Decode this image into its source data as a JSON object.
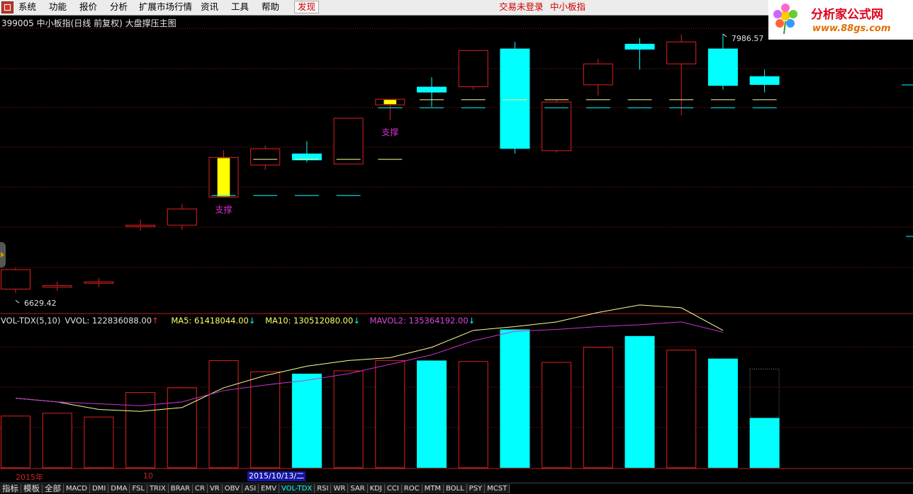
{
  "menu": {
    "items": [
      "系统",
      "功能",
      "报价",
      "分析",
      "扩展市场行情",
      "资讯",
      "工具",
      "帮助"
    ],
    "discover_label": "发现",
    "login_status": "交易未登录",
    "security_name": "中小板指"
  },
  "brand": {
    "title": "分析家公式网",
    "url": "www.88gs.com"
  },
  "chart": {
    "title": "399005 中小板指(日线 前复权) 大盘撑压主图",
    "high_label": "7986.57",
    "low_label": "6629.42",
    "support_label": "支撑"
  },
  "indicator": {
    "name": "VOL-TDX(5,10)",
    "vvol": "VVOL: 122836088.00",
    "vvol_arrow": "↑",
    "ma5": "MA5: 61418044.00",
    "ma5_arrow": "↓",
    "ma10": "MA10: 130512080.00",
    "ma10_arrow": "↓",
    "mavol2": "MAVOL2: 135364192.00",
    "mavol2_arrow": "↓"
  },
  "axis": {
    "year_label": "2015年",
    "month_label": "10",
    "selected_date": "2015/10/13/二"
  },
  "tabs": [
    "指标",
    "模板",
    "全部",
    "MACD",
    "DMI",
    "DMA",
    "FSL",
    "TRIX",
    "BRAR",
    "CR",
    "VR",
    "OBV",
    "ASI",
    "EMV",
    "VOL-TDX",
    "RSI",
    "WR",
    "SAR",
    "KDJ",
    "CCI",
    "ROC",
    "MTM",
    "BOLL",
    "PSY",
    "MCST"
  ],
  "active_tab": "VOL-TDX",
  "colors": {
    "up": "#e02020",
    "down": "#00ffff",
    "highlight": "#ffff00",
    "ma_yellow": "#ffff99",
    "ma_purple": "#cc33cc",
    "grid": "#8b1a1a",
    "support_text": "#cc33cc"
  },
  "chart_data": {
    "type": "candlestick",
    "price_range": [
      6629.42,
      7986.57
    ],
    "candles": [
      {
        "o": 6650,
        "c": 6752,
        "h": 6760,
        "l": 6629,
        "dir": "up"
      },
      {
        "o": 6668,
        "c": 6660,
        "h": 6690,
        "l": 6640,
        "dir": "up"
      },
      {
        "o": 6688,
        "c": 6685,
        "h": 6708,
        "l": 6660,
        "dir": "up"
      },
      {
        "o": 6985,
        "c": 6978,
        "h": 7015,
        "l": 6955,
        "dir": "up"
      },
      {
        "o": 6985,
        "c": 7070,
        "h": 7095,
        "l": 6960,
        "dir": "up"
      },
      {
        "o": 7132,
        "c": 7340,
        "h": 7378,
        "l": 7128,
        "dir": "up",
        "fill": "#ffff00"
      },
      {
        "o": 7300,
        "c": 7385,
        "h": 7400,
        "l": 7275,
        "dir": "up"
      },
      {
        "o": 7360,
        "c": 7325,
        "h": 7425,
        "l": 7315,
        "dir": "down"
      },
      {
        "o": 7305,
        "c": 7545,
        "h": 7545,
        "l": 7305,
        "dir": "up"
      },
      {
        "o": 7615,
        "c": 7645,
        "h": 7645,
        "l": 7535,
        "dir": "up",
        "fill": "#ffff00"
      },
      {
        "o": 7710,
        "c": 7680,
        "h": 7760,
        "l": 7605,
        "dir": "down"
      },
      {
        "o": 7710,
        "c": 7900,
        "h": 7900,
        "l": 7695,
        "dir": "up"
      },
      {
        "o": 7910,
        "c": 7385,
        "h": 7945,
        "l": 7360,
        "dir": "down"
      },
      {
        "o": 7375,
        "c": 7630,
        "h": 7640,
        "l": 7365,
        "dir": "up"
      },
      {
        "o": 7720,
        "c": 7830,
        "h": 7855,
        "l": 7665,
        "dir": "up"
      },
      {
        "o": 7935,
        "c": 7905,
        "h": 7965,
        "l": 7800,
        "dir": "down"
      },
      {
        "o": 7830,
        "c": 7945,
        "h": 7985,
        "l": 7560,
        "dir": "up"
      },
      {
        "o": 7910,
        "c": 7715,
        "h": 7986.57,
        "l": 7695,
        "dir": "down"
      },
      {
        "o": 7765,
        "c": 7720,
        "h": 7800,
        "l": 7680,
        "dir": "down"
      }
    ],
    "support_levels": [
      {
        "from": 5,
        "to": 8,
        "value": 7140,
        "color": "#00ffff"
      },
      {
        "from": 6,
        "to": 9,
        "value": 7330,
        "color": "#ffff99"
      },
      {
        "from": 9,
        "to": 18,
        "value": 7600,
        "color": "#00ffff"
      },
      {
        "from": 10,
        "to": 18,
        "value": 7642,
        "color": "#ffff99"
      }
    ],
    "support_marks": [
      {
        "index": 5
      },
      {
        "index": 9
      }
    ],
    "volume": [
      {
        "v": 55,
        "dir": "up"
      },
      {
        "v": 58,
        "dir": "up"
      },
      {
        "v": 54,
        "dir": "up"
      },
      {
        "v": 80,
        "dir": "up"
      },
      {
        "v": 85,
        "dir": "up"
      },
      {
        "v": 114,
        "dir": "up"
      },
      {
        "v": 102,
        "dir": "up"
      },
      {
        "v": 100,
        "dir": "down"
      },
      {
        "v": 103,
        "dir": "up"
      },
      {
        "v": 114,
        "dir": "up"
      },
      {
        "v": 114,
        "dir": "down"
      },
      {
        "v": 113,
        "dir": "up"
      },
      {
        "v": 147,
        "dir": "down"
      },
      {
        "v": 112,
        "dir": "up"
      },
      {
        "v": 128,
        "dir": "up"
      },
      {
        "v": 140,
        "dir": "down"
      },
      {
        "v": 125,
        "dir": "up"
      },
      {
        "v": 116,
        "dir": "down"
      },
      {
        "v": 53,
        "dir": "down",
        "partial_outline": 105
      }
    ],
    "ma_yellow": [
      74,
      70,
      62,
      60,
      64,
      85,
      98,
      108,
      114,
      117,
      128,
      146,
      150,
      155,
      165,
      173,
      170,
      146
    ],
    "ma_purple": [
      74,
      70,
      68,
      66,
      70,
      82,
      88,
      93,
      100,
      110,
      120,
      135,
      145,
      147,
      150,
      152,
      155,
      144
    ]
  }
}
